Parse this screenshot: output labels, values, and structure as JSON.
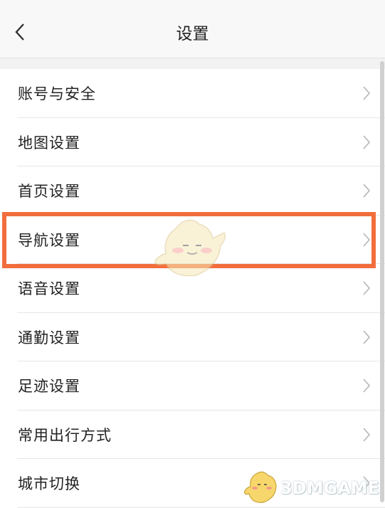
{
  "header": {
    "title": "设置",
    "back_icon": "chevron-left-icon"
  },
  "settings": {
    "items": [
      {
        "label": "账号与安全"
      },
      {
        "label": "地图设置"
      },
      {
        "label": "首页设置"
      },
      {
        "label": "导航设置"
      },
      {
        "label": "语音设置"
      },
      {
        "label": "通勤设置"
      },
      {
        "label": "足迹设置"
      },
      {
        "label": "常用出行方式"
      },
      {
        "label": "城市切换"
      }
    ],
    "highlighted_index": 3
  },
  "watermark": {
    "text": "3DMGAME"
  },
  "colors": {
    "highlight": "#f26d3d",
    "header_bg": "#f8f8f8",
    "chevron": "#b5b5b5"
  }
}
